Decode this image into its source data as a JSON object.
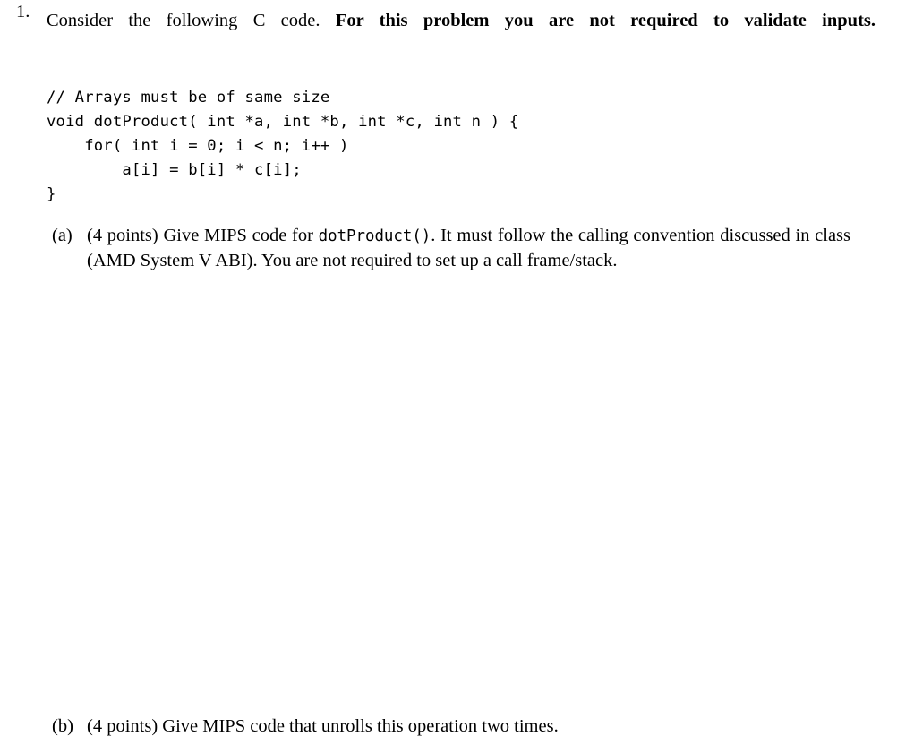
{
  "document": {
    "type": "exam-problem-sheet"
  },
  "problem": {
    "marker": "1.",
    "stem_normal": "Consider the following C code. ",
    "stem_bold": "For this problem you are not required to validate inputs.",
    "code_listing": "// Arrays must be of same size\nvoid dotProduct( int *a, int *b, int *c, int n ) {\n    for( int i = 0; i < n; i++ )\n        a[i] = b[i] * c[i];\n}"
  },
  "subparts": [
    {
      "marker": "(a)",
      "points": "(4 points)",
      "text_before_code": " Give MIPS code for ",
      "inline_code": "dotProduct()",
      "text_after_code": ". It must follow the calling convention discussed in class (AMD System V ABI). You are not required to set up a call frame/stack."
    },
    {
      "marker": "(b)",
      "points": "(4 points)",
      "text": " Give MIPS code that unrolls this operation two times."
    }
  ]
}
